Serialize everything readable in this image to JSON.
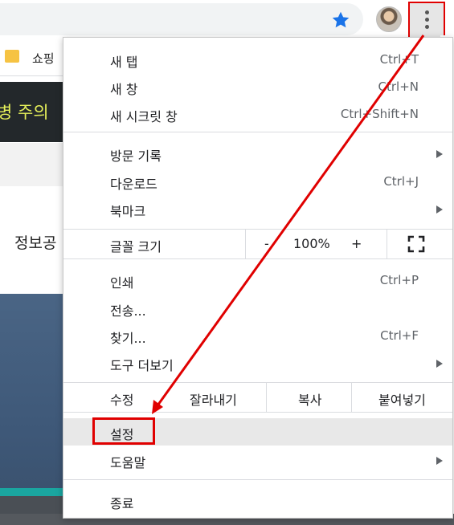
{
  "bookmarks_bar": {
    "items": [
      {
        "label": "쇼핑"
      }
    ]
  },
  "page_background": {
    "banner_text": "병 주의",
    "heading_text": "정보공"
  },
  "toolbar": {
    "star_icon": "star-icon",
    "menu_icon": "kebab-menu-icon"
  },
  "menu": {
    "new_tab": {
      "label": "새 탭",
      "shortcut": "Ctrl+T"
    },
    "new_window": {
      "label": "새 창",
      "shortcut": "Ctrl+N"
    },
    "incognito": {
      "label": "새 시크릿 창",
      "shortcut": "Ctrl+Shift+N"
    },
    "history": {
      "label": "방문 기록"
    },
    "downloads": {
      "label": "다운로드",
      "shortcut": "Ctrl+J"
    },
    "bookmarks": {
      "label": "북마크"
    },
    "zoom": {
      "label": "글꼴 크기",
      "minus": "-",
      "value": "100%",
      "plus": "+"
    },
    "print": {
      "label": "인쇄",
      "shortcut": "Ctrl+P"
    },
    "cast": {
      "label": "전송..."
    },
    "find": {
      "label": "찾기...",
      "shortcut": "Ctrl+F"
    },
    "more_tools": {
      "label": "도구 더보기"
    },
    "edit": {
      "label": "수정",
      "cut": "잘라내기",
      "copy": "복사",
      "paste": "붙여넣기"
    },
    "settings": {
      "label": "설정"
    },
    "help": {
      "label": "도움말"
    },
    "exit": {
      "label": "종료"
    }
  },
  "colors": {
    "annotation": "#e00000",
    "star": "#1a73e8"
  }
}
